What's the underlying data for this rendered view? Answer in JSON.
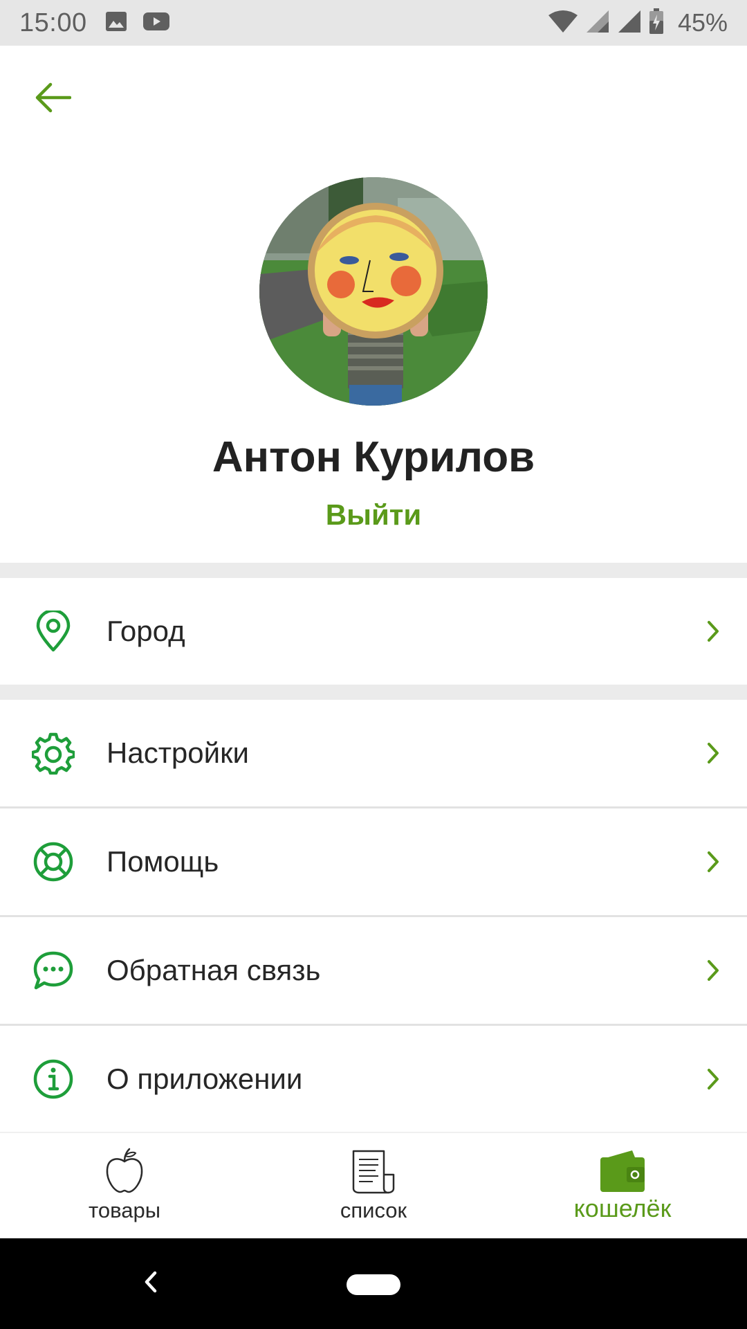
{
  "status_bar": {
    "time": "15:00",
    "battery_text": "45%",
    "left_icons": [
      "image-icon",
      "youtube-icon"
    ],
    "right_icons": [
      "wifi-icon",
      "signal-icon",
      "signal-icon",
      "battery-icon"
    ]
  },
  "header": {
    "back_icon": "arrow-left-icon"
  },
  "profile": {
    "name": "Антон Курилов",
    "logout_label": "Выйти"
  },
  "menu": {
    "items": [
      {
        "label": "Город",
        "icon": "location-pin-icon"
      },
      {
        "label": "Настройки",
        "icon": "gear-icon"
      },
      {
        "label": "Помощь",
        "icon": "lifebuoy-icon"
      },
      {
        "label": "Обратная связь",
        "icon": "chat-bubble-icon"
      },
      {
        "label": "О приложении",
        "icon": "info-icon"
      }
    ]
  },
  "bottom_nav": {
    "items": [
      {
        "label": "товары",
        "icon": "apple-icon",
        "active": false
      },
      {
        "label": "список",
        "icon": "receipt-list-icon",
        "active": false
      },
      {
        "label": "кошелёк",
        "icon": "wallet-icon",
        "active": true
      }
    ]
  },
  "colors": {
    "accent": "#5a9a1a",
    "icon_green": "#1e9e3a",
    "text_dark": "#222222",
    "section_gap": "#ebebeb",
    "status_bar_bg": "#e6e6e6"
  }
}
